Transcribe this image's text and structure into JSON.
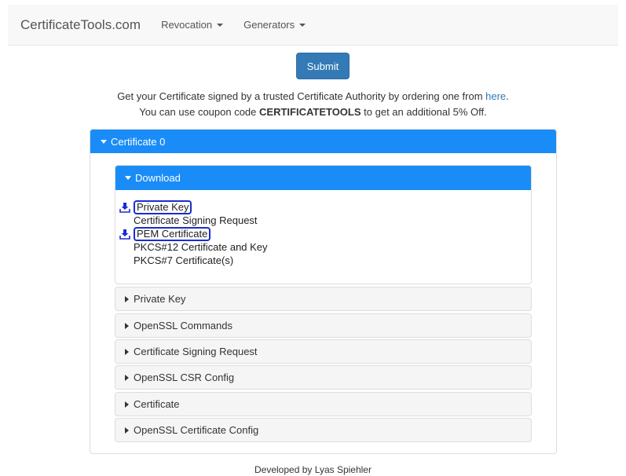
{
  "navbar": {
    "brand": "CertificateTools.com",
    "menus": [
      {
        "label": "Revocation"
      },
      {
        "label": "Generators"
      }
    ]
  },
  "submit_label": "Submit",
  "info": {
    "line1_prefix": "Get your Certificate signed by a trusted Certificate Authority by ordering one from ",
    "line1_link": "here",
    "line1_suffix": ".",
    "line2_prefix": "You can use coupon code ",
    "coupon": "CERTIFICATETOOLS",
    "line2_suffix": " to get an additional 5% Off."
  },
  "certificate_panel": {
    "heading": "Certificate 0",
    "download": {
      "heading": "Download",
      "items": [
        {
          "label": "Private Key",
          "icon": "download-icon"
        },
        {
          "label": "Certificate Signing Request",
          "icon": ""
        },
        {
          "label": "PEM Certificate",
          "icon": "download-icon"
        },
        {
          "label": "PKCS#12 Certificate and Key",
          "icon": ""
        },
        {
          "label": "PKCS#7 Certificate(s)",
          "icon": ""
        }
      ]
    },
    "sections": [
      "Private Key",
      "OpenSSL Commands",
      "Certificate Signing Request",
      "OpenSSL CSR Config",
      "Certificate",
      "OpenSSL Certificate Config"
    ]
  },
  "footer": "Developed by Lyas Spiehler",
  "colors": {
    "primary": "#337ab7",
    "panel_heading": "#1a8cf7",
    "outline": "#1a2bd1"
  }
}
